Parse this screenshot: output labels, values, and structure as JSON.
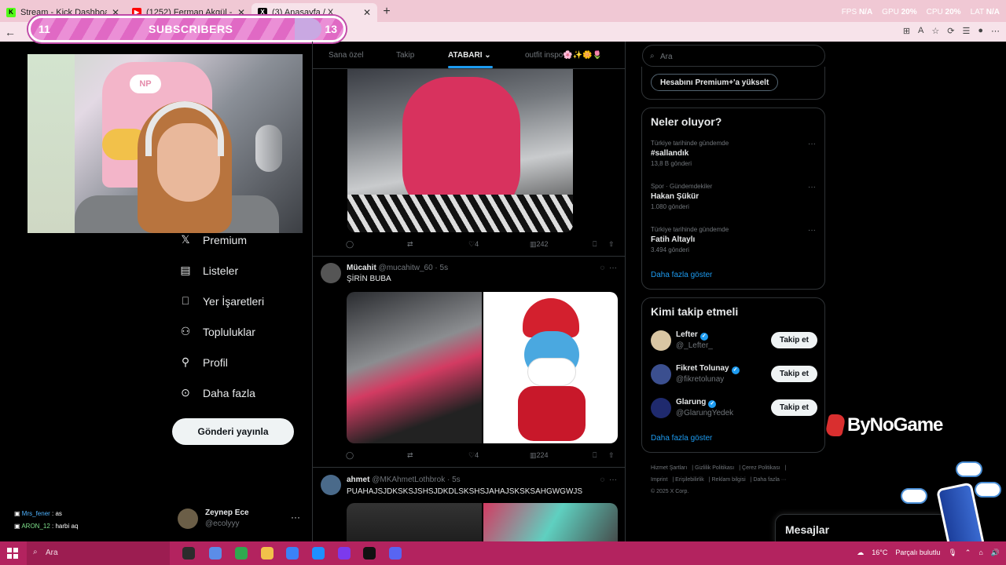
{
  "browser": {
    "tabs": [
      {
        "title": "Stream - Kick Dashboard",
        "fav_color": "#53fc18",
        "active": false
      },
      {
        "title": "(1252) Ferman Akgül - İstemem Sö",
        "fav_color": "#ff0000",
        "active": false
      },
      {
        "title": "(3) Anasayfa / X",
        "fav_color": "#000000",
        "active": true
      }
    ],
    "new_tab": "+",
    "stats": {
      "fps_label": "FPS",
      "fps": "N/A",
      "gpu_label": "GPU",
      "gpu": "20%",
      "cpu_label": "CPU",
      "cpu": "20%",
      "lat_label": "LAT",
      "lat": "N/A"
    }
  },
  "overlay": {
    "sub_goal": {
      "current": "11",
      "label": "SUBSCRIBERS",
      "target": "13",
      "progress": 0.85
    },
    "chat": [
      {
        "user": "Mrs_fener",
        "msg": "as"
      },
      {
        "user": "ARON_12",
        "msg": "harbi aq"
      }
    ],
    "watermark": "ByNoGame"
  },
  "x": {
    "nav": [
      {
        "label": "Premium",
        "icon": "x-logo-icon"
      },
      {
        "label": "Listeler",
        "icon": "list-icon"
      },
      {
        "label": "Yer İşaretleri",
        "icon": "bookmark-icon"
      },
      {
        "label": "Topluluklar",
        "icon": "communities-icon"
      },
      {
        "label": "Profil",
        "icon": "profile-icon"
      },
      {
        "label": "Daha fazla",
        "icon": "more-circle-icon"
      }
    ],
    "post_button": "Gönderi yayınla",
    "account": {
      "name": "Zeynep Ece",
      "handle": "@ecolyyy"
    },
    "timeline_tabs": [
      "Sana özel",
      "Takip",
      "ATABARI",
      "outfit inspo🌸✨🌼🌷"
    ],
    "post0": {
      "likes": "4",
      "views": "242"
    },
    "post1": {
      "name": "Mücahit",
      "handle": "@mucahitw_60 · 5s",
      "text": "ŞİRİN BUBA",
      "likes": "4",
      "views": "224"
    },
    "post2": {
      "name": "ahmet",
      "handle": "@MKAhmetLothbrok · 5s",
      "text": "PUAHAJSJDKSKSJSHSJDKDLSKSHSJAHAJSKSKSAHGWGWJS"
    },
    "search_placeholder": "Ara",
    "premium_upgrade": "Hesabını Premium+'a yükselt",
    "trends_title": "Neler oluyor?",
    "trends": [
      {
        "category": "Türkiye tarihinde gündemde",
        "title": "#sallandık",
        "count": "13,8 B gönderi"
      },
      {
        "category": "Spor · Gündemdekiler",
        "title": "Hakan Şükür",
        "count": "1.080 gönderi"
      },
      {
        "category": "Türkiye tarihinde gündemde",
        "title": "Fatih Altaylı",
        "count": "3.494 gönderi"
      }
    ],
    "show_more": "Daha fazla göster",
    "who_to_follow_title": "Kimi takip etmeli",
    "who_to_follow": [
      {
        "name": "Lefter",
        "handle": "@_Lefter_",
        "color": "#d9c6a3"
      },
      {
        "name": "Fikret Tolunay",
        "handle": "@fikretolunay",
        "color": "#3b4f8f"
      },
      {
        "name": "Glarung",
        "handle": "@GlarungYedek",
        "color": "#1f2a6e"
      }
    ],
    "follow_button": "Takip et",
    "footer": [
      "Hizmet Şartları",
      "Gizlilik Politikası",
      "Çerez Politikası",
      "Imprint",
      "Erişilebilirlik",
      "Reklam bilgisi",
      "Daha fazla ···",
      "© 2025 X Corp."
    ],
    "messages": "Mesajlar"
  },
  "taskbar": {
    "search": "Ara",
    "weather": "16°C",
    "weather_desc": "Parçalı bulutlu"
  }
}
